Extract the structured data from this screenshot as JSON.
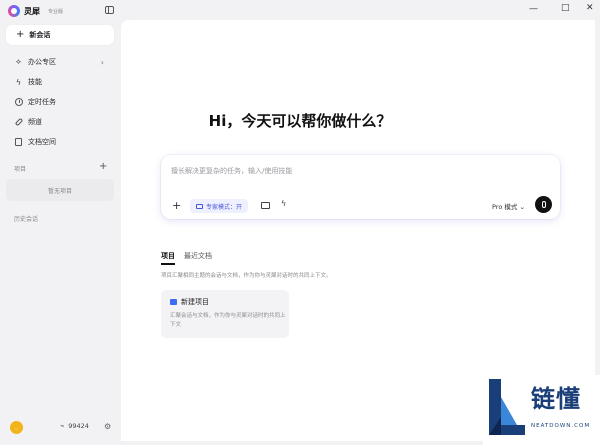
{
  "app": {
    "name": "灵犀",
    "tier": "专业版"
  },
  "sidebar": {
    "new_chat": "新会话",
    "items": [
      {
        "label": "办公专区",
        "icon": "office-icon"
      },
      {
        "label": "技能",
        "icon": "lightning-icon"
      },
      {
        "label": "定时任务",
        "icon": "clock-icon"
      },
      {
        "label": "频道",
        "icon": "link-icon"
      },
      {
        "label": "文档空间",
        "icon": "document-icon"
      }
    ],
    "projects_label": "项目",
    "projects_empty": "暂无项目",
    "history_label": "历史会话",
    "points": "99424"
  },
  "main": {
    "greeting": "Hi，今天可以帮你做什么？",
    "input_placeholder": "擅长解决更复杂的任务，输入/使用技能",
    "expert_mode": "专家模式：开",
    "pro_mode": "Pro 模式",
    "tabs": [
      {
        "label": "项目"
      },
      {
        "label": "最近文档"
      }
    ],
    "tab_description": "项目汇聚相同主题的会话与文档，作为你与灵犀对话时的共同上下文。",
    "new_project": {
      "title": "新建项目",
      "description": "汇聚会话与文档，作为你与灵犀对话时的共同上下文"
    }
  },
  "watermark": {
    "name": "链懂",
    "sub": "NEATDOWN.COM"
  }
}
